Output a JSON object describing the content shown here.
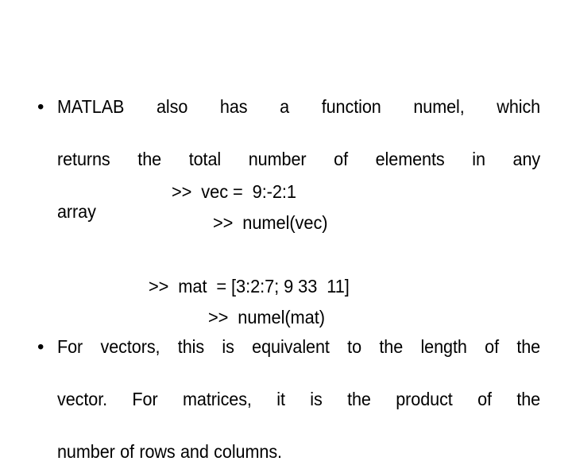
{
  "slide": {
    "background_color": "#ffffff",
    "text_color": "#000000",
    "bullet_glyph": "•"
  },
  "bullets": [
    {
      "id": "bullet-one",
      "marker": "•",
      "lines": [
        "MATLAB  also  has  a  function   numel,  which",
        "returns   the  total  number  of elements  in any",
        "array"
      ],
      "text": "MATLAB also has a function numel, which returns the total number of elements in any array"
    },
    {
      "id": "bullet-two",
      "marker": "•",
      "lines": [
        "For vectors, this is equivalent  to the length of the",
        "vector.  For  matrices,  it  is  the  product   of  the",
        "number of rows and  columns."
      ],
      "text": "For vectors, this is equivalent to the length of the vector. For matrices, it is the product of the number of rows and columns."
    }
  ],
  "code_lines": [
    {
      "id": "code-vec",
      "text": ">>  vec =  9:-2:1"
    },
    {
      "id": "code-numelvec",
      "text": ">>  numel(vec)"
    },
    {
      "id": "code-mat",
      "text": ">>  mat  = [3:2:7; 9 33  11]"
    },
    {
      "id": "code-numelmat",
      "text": ">>  numel(mat)"
    }
  ]
}
